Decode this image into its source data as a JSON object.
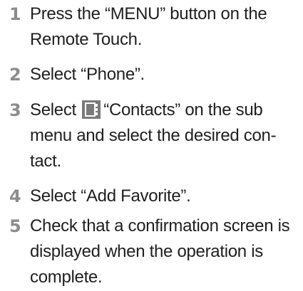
{
  "steps": [
    {
      "number": "1",
      "lines": [
        "Press the “MENU” button on the",
        "Remote Touch."
      ]
    },
    {
      "number": "2",
      "lines": [
        "Select “Phone”."
      ]
    },
    {
      "number": "3",
      "line1_before_icon": "Select",
      "line1_after_icon": "“Contacts” on the sub",
      "icon": "contacts-icon",
      "lines_rest": [
        "menu and select the desired con-",
        "tact."
      ]
    },
    {
      "number": "4",
      "lines": [
        "Select “Add Favorite”."
      ]
    },
    {
      "number": "5",
      "lines": [
        "Check that a confirmation screen is",
        "displayed when the operation is",
        "complete."
      ]
    }
  ],
  "colors": {
    "step_number": "#8c8c8c",
    "text": "#1f1f1f",
    "icon_fill": "#7a7a7a"
  }
}
